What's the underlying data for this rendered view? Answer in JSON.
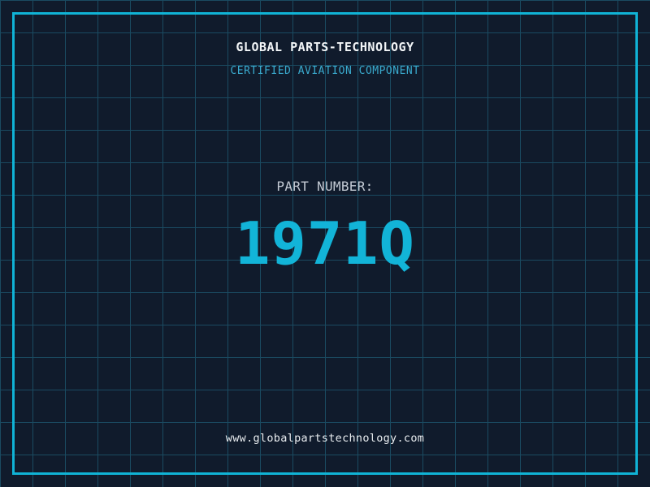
{
  "brand": {
    "title": "GLOBAL PARTS-TECHNOLOGY",
    "subtitle": "CERTIFIED AVIATION COMPONENT"
  },
  "part": {
    "label": "PART NUMBER:",
    "number": "1971Q"
  },
  "footer": {
    "website": "www.globalpartstechnology.com"
  },
  "colors": {
    "background": "#101b2c",
    "grid_line": "#1a4a61",
    "frame": "#10b3d6",
    "title": "#f2f5f7",
    "subtitle": "#3aabcf",
    "part_label": "#c3cad4",
    "part_number": "#12b4d8",
    "website": "#e8ecef"
  }
}
